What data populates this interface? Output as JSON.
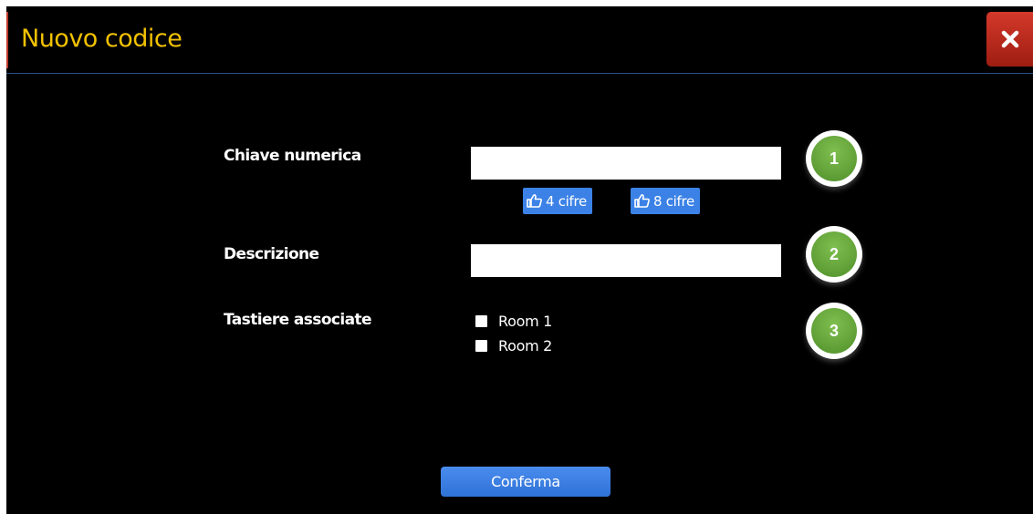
{
  "dialog": {
    "title": "Nuovo codice",
    "close_icon": "close-icon",
    "colors": {
      "title": "#f2c200",
      "close_bg": "#c0392b",
      "button": "#3c82e6",
      "badge": "#5ea33a"
    }
  },
  "form": {
    "key": {
      "label": "Chiave numerica",
      "value": "",
      "presets": [
        {
          "label": "4 cifre",
          "icon": "thumbs-up-icon"
        },
        {
          "label": "8 cifre",
          "icon": "thumbs-up-icon"
        }
      ],
      "step": "1"
    },
    "description": {
      "label": "Descrizione",
      "value": "",
      "step": "2"
    },
    "keypads": {
      "label": "Tastiere associate",
      "options": [
        {
          "label": "Room 1",
          "checked": false
        },
        {
          "label": "Room 2",
          "checked": false
        }
      ],
      "step": "3"
    }
  },
  "confirm_label": "Conferma"
}
